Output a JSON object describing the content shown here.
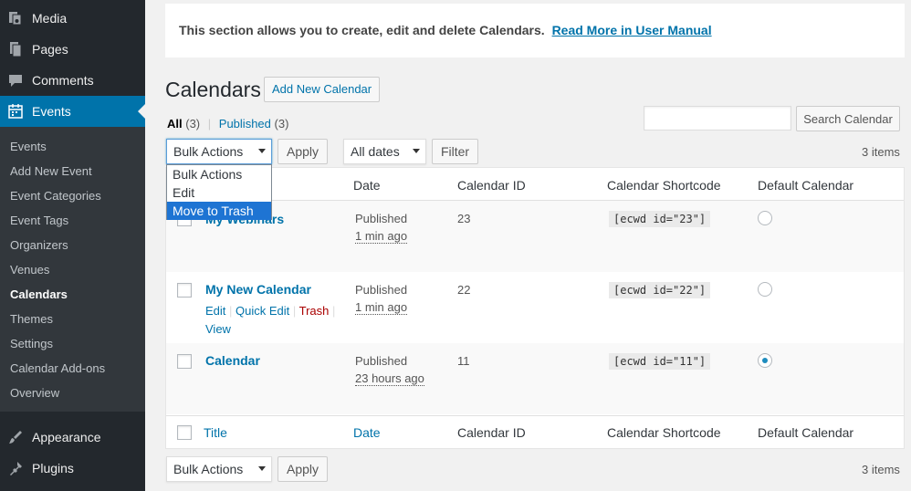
{
  "sidebar": {
    "top_items": [
      {
        "label": "Media",
        "icon": "media-icon"
      },
      {
        "label": "Pages",
        "icon": "pages-icon"
      },
      {
        "label": "Comments",
        "icon": "comments-icon"
      },
      {
        "label": "Events",
        "icon": "calendar-icon",
        "active": true
      }
    ],
    "submenu": [
      "Events",
      "Add New Event",
      "Event Categories",
      "Event Tags",
      "Organizers",
      "Venues",
      "Calendars",
      "Themes",
      "Settings",
      "Calendar Add-ons",
      "Overview"
    ],
    "submenu_current": "Calendars",
    "bottom_items": [
      {
        "label": "Appearance",
        "icon": "appearance-icon"
      },
      {
        "label": "Plugins",
        "icon": "plugins-icon"
      }
    ]
  },
  "notice": {
    "text": "This section allows you to create, edit and delete Calendars.",
    "link": "Read More in User Manual"
  },
  "header": {
    "title": "Calendars",
    "add_new": "Add New Calendar"
  },
  "views": {
    "all_label": "All",
    "all_count": "(3)",
    "published_label": "Published",
    "published_count": "(3)"
  },
  "search": {
    "button": "Search Calendar",
    "value": ""
  },
  "tablenav_top": {
    "bulk_selected": "Bulk Actions",
    "apply": "Apply",
    "dates_selected": "All dates",
    "filter": "Filter",
    "count": "3 items"
  },
  "bulk_dropdown": {
    "options": [
      "Bulk Actions",
      "Edit",
      "Move to Trash"
    ],
    "highlighted": "Move to Trash"
  },
  "table": {
    "columns": [
      "Title",
      "Date",
      "Calendar ID",
      "Calendar Shortcode",
      "Default Calendar"
    ],
    "rows": [
      {
        "title": "My Webinars",
        "status": "Published",
        "time": "1 min ago",
        "id": "23",
        "shortcode": "[ecwd id=\"23\"]",
        "default": false
      },
      {
        "title": "My New Calendar",
        "status": "Published",
        "time": "1 min ago",
        "id": "22",
        "shortcode": "[ecwd id=\"22\"]",
        "default": false,
        "actions": {
          "edit": "Edit",
          "quick_edit": "Quick Edit",
          "trash": "Trash",
          "view": "View"
        }
      },
      {
        "title": "Calendar",
        "status": "Published",
        "time": "23 hours ago",
        "id": "11",
        "shortcode": "[ecwd id=\"11\"]",
        "default": true
      }
    ]
  },
  "tablenav_bottom": {
    "bulk_selected": "Bulk Actions",
    "apply": "Apply",
    "count": "3 items"
  },
  "colors": {
    "sidebar_bg": "#23282d",
    "submenu_bg": "#32373c",
    "accent": "#0073aa",
    "highlight": "#1e74d3",
    "trash": "#a00"
  }
}
